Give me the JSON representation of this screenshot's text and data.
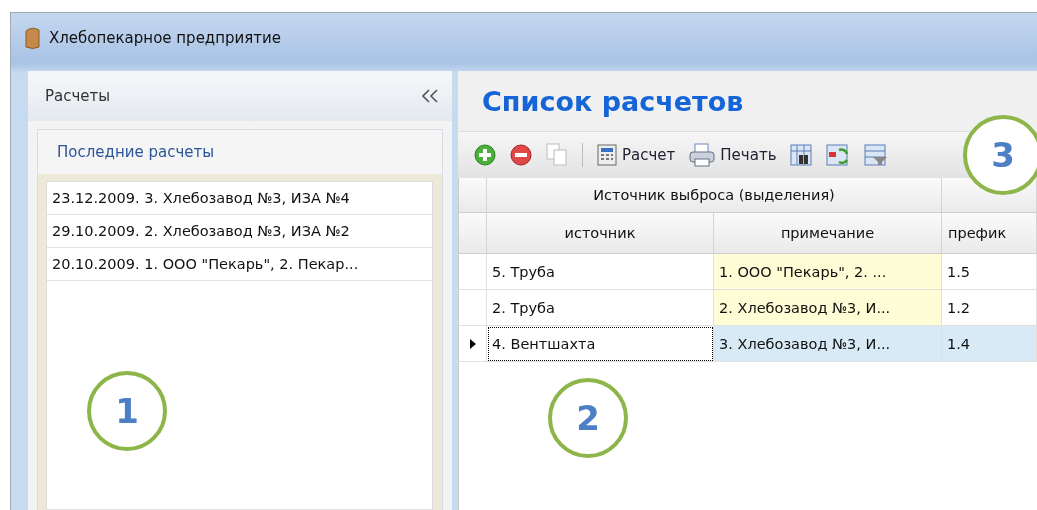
{
  "window": {
    "title": "Хлебопекарное предприятие"
  },
  "sidebar": {
    "title": "Расчеты",
    "group": {
      "title": "Последние расчеты",
      "items": [
        {
          "text": "23.12.2009. 3. Хлебозавод №3, ИЗА №4"
        },
        {
          "text": "29.10.2009. 2. Хлебозавод №3, ИЗА №2"
        },
        {
          "text": "20.10.2009. 1. ООО \"Пекарь\", 2. Пекар..."
        }
      ]
    }
  },
  "main": {
    "title": "Список расчетов",
    "toolbar": [
      {
        "kind": "add"
      },
      {
        "kind": "remove"
      },
      {
        "kind": "copy"
      },
      {
        "kind": "separator"
      },
      {
        "kind": "calc",
        "label": "Расчет"
      },
      {
        "kind": "print",
        "label": "Печать"
      },
      {
        "kind": "find"
      },
      {
        "kind": "refresh"
      },
      {
        "kind": "filter"
      }
    ],
    "table": {
      "group_header": "Источник выброса (выделения)",
      "columns": [
        "источник",
        "примечание",
        "префик"
      ],
      "rows": [
        {
          "cells": [
            "5. Труба",
            "1. ООО \"Пекарь\", 2. ...",
            "1.5"
          ],
          "selected": false
        },
        {
          "cells": [
            "2. Труба",
            "2. Хлебозавод №3, И...",
            "1.2"
          ],
          "selected": false
        },
        {
          "cells": [
            "4. Вентшахта",
            "3. Хлебозавод №3, И...",
            "1.4"
          ],
          "selected": true
        }
      ]
    }
  },
  "callouts": [
    {
      "label": "1"
    },
    {
      "label": "2"
    },
    {
      "label": "3"
    }
  ]
}
